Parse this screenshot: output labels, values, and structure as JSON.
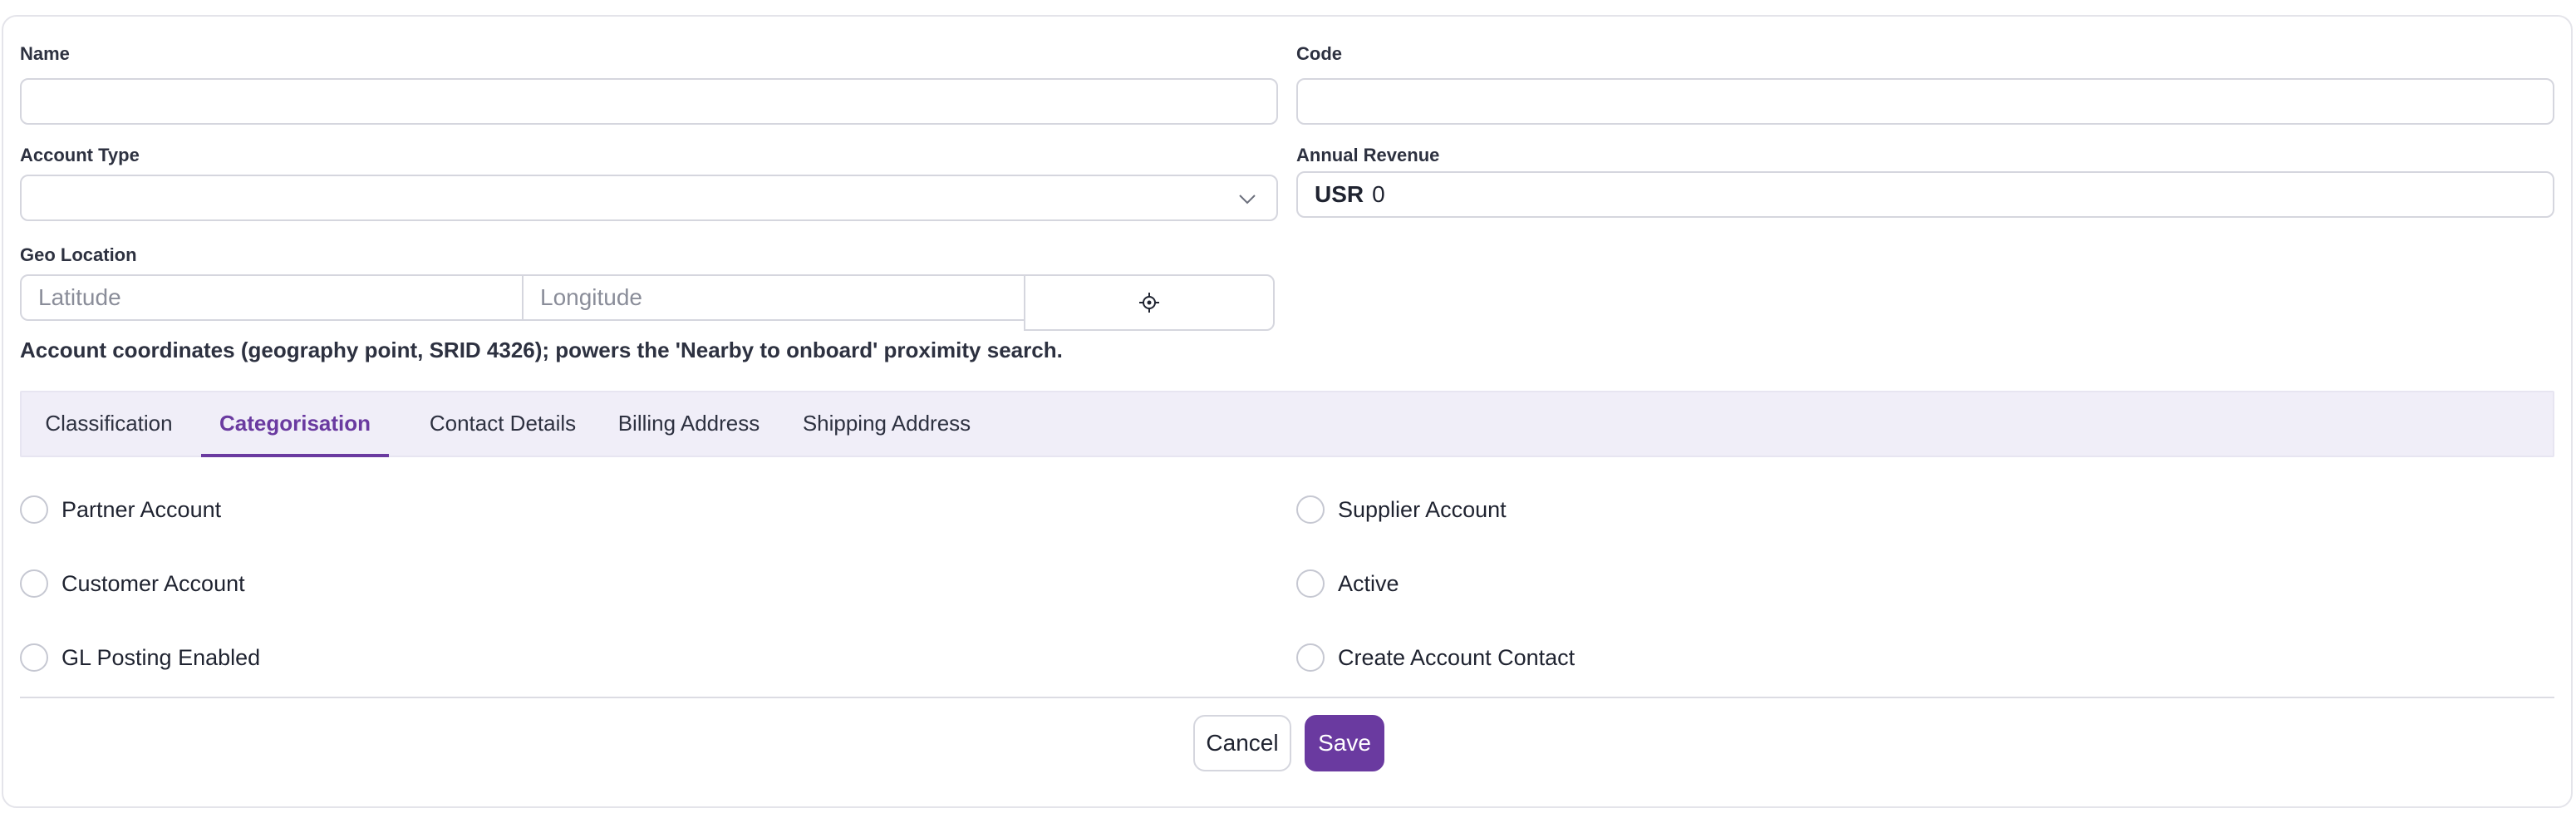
{
  "form": {
    "name_label": "Name",
    "name_value": "",
    "code_label": "Code",
    "code_value": "",
    "account_type_label": "Account Type",
    "account_type_value": "",
    "annual_revenue_label": "Annual Revenue",
    "annual_revenue_currency": "USR",
    "annual_revenue_value": "0",
    "geo_label": "Geo Location",
    "latitude_placeholder": "Latitude",
    "longitude_placeholder": "Longitude",
    "geo_help": "Account coordinates (geography point, SRID 4326); powers the 'Nearby to onboard' proximity search."
  },
  "tabs": [
    {
      "label": "Classification",
      "active": false
    },
    {
      "label": "Categorisation",
      "active": true
    },
    {
      "label": "Contact Details",
      "active": false
    },
    {
      "label": "Billing Address",
      "active": false
    },
    {
      "label": "Shipping Address",
      "active": false
    }
  ],
  "checkboxes": [
    {
      "label": "Partner Account",
      "checked": false
    },
    {
      "label": "Supplier Account",
      "checked": false
    },
    {
      "label": "Customer Account",
      "checked": false
    },
    {
      "label": "Active",
      "checked": false
    },
    {
      "label": "GL Posting Enabled",
      "checked": false
    },
    {
      "label": "Create Account Contact",
      "checked": false
    }
  ],
  "actions": {
    "cancel_label": "Cancel",
    "save_label": "Save"
  },
  "colors": {
    "accent": "#6a3aa0",
    "tab_bar_bg": "#f0eef8",
    "border": "#d5d6de"
  },
  "icons": {
    "account_type_dropdown": "chevron-down-icon",
    "locate": "crosshair-icon"
  }
}
